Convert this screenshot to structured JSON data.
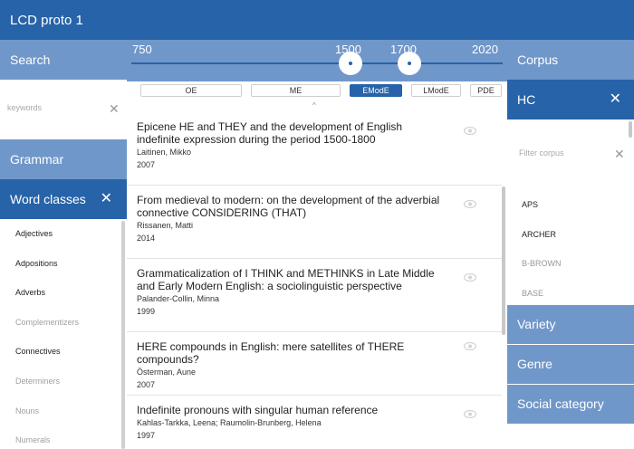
{
  "app": {
    "title": "LCD proto 1"
  },
  "search": {
    "header": "Search",
    "keywords_placeholder": "keywords",
    "clear_label": "✕"
  },
  "grammar": {
    "header": "Grammar"
  },
  "word_classes": {
    "header": "Word classes",
    "close_label": "✕",
    "items": [
      {
        "label": "Adjectives",
        "enabled": true
      },
      {
        "label": "Adpositions",
        "enabled": true
      },
      {
        "label": "Adverbs",
        "enabled": true
      },
      {
        "label": "Complementizers",
        "enabled": false
      },
      {
        "label": "Connectives",
        "enabled": true
      },
      {
        "label": "Determiners",
        "enabled": false
      },
      {
        "label": "Nouns",
        "enabled": false
      },
      {
        "label": "Numerals",
        "enabled": false
      }
    ]
  },
  "timeline": {
    "min_label": "750",
    "start_label": "1500",
    "end_label": "1700",
    "max_label": "2020",
    "min": 750,
    "max": 2020,
    "start": 1500,
    "end": 1700
  },
  "periods": [
    {
      "label": "OE",
      "active": false
    },
    {
      "label": "ME",
      "active": false
    },
    {
      "label": "EModE",
      "active": true
    },
    {
      "label": "LModE",
      "active": false
    },
    {
      "label": "PDE",
      "active": false
    }
  ],
  "collapse_caret": "^",
  "results": [
    {
      "title": "Epicene HE and THEY and the development of English indefinite expression during the period 1500-1800",
      "authors": "Laitinen, Mikko",
      "year": "2007"
    },
    {
      "title": "From medieval to modern: on the development of the adverbial connective CONSIDERING (THAT)",
      "authors": "Rissanen, Matti",
      "year": "2014"
    },
    {
      "title": "Grammaticalization of I THINK and METHINKS in Late Middle and Early Modern English: a sociolinguistic perspective",
      "authors": "Palander-Collin, Minna",
      "year": "1999"
    },
    {
      "title": "HERE compounds in English: mere satellites of THERE compounds?",
      "authors": "Österman, Aune",
      "year": "2007"
    },
    {
      "title": "Indefinite pronouns with singular human reference",
      "authors": "Kahlas-Tarkka, Leena; Raumolin-Brunberg, Helena",
      "year": "1997"
    }
  ],
  "corpus": {
    "header": "Corpus",
    "selected": "HC",
    "close_label": "✕",
    "filter_placeholder": "Filter corpus",
    "clear_label": "✕",
    "items": [
      {
        "label": "APS",
        "enabled": true
      },
      {
        "label": "ARCHER",
        "enabled": true
      },
      {
        "label": "B-BROWN",
        "enabled": false
      },
      {
        "label": "BASE",
        "enabled": false
      }
    ]
  },
  "facets": [
    {
      "label": "Variety"
    },
    {
      "label": "Genre"
    },
    {
      "label": "Social category"
    }
  ],
  "colors": {
    "primary": "#2763a8",
    "secondary": "#7097c9"
  }
}
